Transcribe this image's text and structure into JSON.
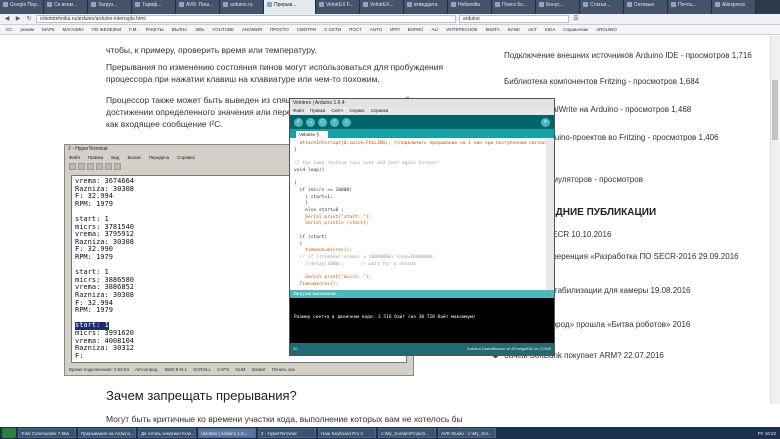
{
  "browser": {
    "tabs": [
      {
        "label": "Google Пер...",
        "active": false
      },
      {
        "label": "Се всем...",
        "active": false
      },
      {
        "label": "Загруз...",
        "active": false
      },
      {
        "label": "Тариф...",
        "active": false
      },
      {
        "label": "AVR: Пиш...",
        "active": false
      },
      {
        "label": "arduino.ru",
        "active": false
      },
      {
        "label": "Прерыв...",
        "active": true
      },
      {
        "label": "VelotrEX F...",
        "active": false
      },
      {
        "label": "VelotrEX...",
        "active": false
      },
      {
        "label": "втведдета",
        "active": false
      },
      {
        "label": "Hellomitla",
        "active": false
      },
      {
        "label": "Поиск бо...",
        "active": false
      },
      {
        "label": "Бонус...",
        "active": false
      },
      {
        "label": "Статьи...",
        "active": false
      },
      {
        "label": "Сетевые",
        "active": false
      },
      {
        "label": "Почта...",
        "active": false
      },
      {
        "label": "Aliexpress",
        "active": false
      }
    ],
    "url": "robototehnika.ru/arduino/arduino-interrupts.html",
    "search_value": "arduino",
    "bookmarks": [
      "СС",
      "режим",
      "МАРК",
      "МАГАЗИН",
      "ПО ЖЕЛЕЗКИ",
      "F.M.",
      "РАКЕТЫ",
      "ВЪЛНА",
      "ЗВЪ",
      "YOUTUBE",
      "АНОМИЯ",
      "ПРОСТО",
      "СМОТРИ",
      "С-СЕТИ",
      "ПОСТ",
      "ANTO",
      "ИРП",
      "БОРИС",
      "ALI",
      "ИНТЕРЕСНОЕ",
      "КНИГА",
      "BANK",
      "AKT",
      "KIDA",
      "Справочник",
      "ARDUINO"
    ]
  },
  "article": {
    "para_top": "чтобы, к примеру, проверить время или температуру.",
    "para1": "Прерывания по изменению состояния пинов могут использоваться для пробуждения процессора при нажатии клавиш на клавиатуре или чем-то похожим.",
    "para2": "Процессор также может быть выведен из спящего режима прерыванием таймера при достижении определенного значения или переполнении, или другими событиями, такими как входящее сообщение I²C.",
    "heading2": "Зачем запрещать прерывания?",
    "para3": "Могут быть критичные ко времени участки кода, выполнение которых вам не хотелось бы"
  },
  "sidebar": {
    "items": [
      "Подключение внешних источников Arduino IDE - просмотров 1,716",
      "Библиотека компонентов Fritzing - просмотров 1,684",
      "Функции digitalWrite на Arduino - просмотров 1,468",
      "Создание Arduino-проектов во Fritzing - просмотров 1,406",
      "Зарядка аккумуляторов - просмотров"
    ],
    "heading": "ПОСЛЕДНИЕ ПУБЛИКАЦИИ",
    "recent": [
      "Доступный SECR 10.10.2016",
      "Научная конференция «Разработка ПО SECR-2016 29.09.2016",
      "Платформа стабилизации для камеры 19.08.2016",
      "Тест «Нано-город» прошла «Битва роботов» 2016",
      "Зачем SoftBank покупает ARM? 22.07.2016"
    ]
  },
  "terminal": {
    "title": "2 - HyperTerminal",
    "menu": [
      "Файл",
      "Правка",
      "Вид",
      "Вызов",
      "Передача",
      "Справка"
    ],
    "lines": [
      {
        "text": "vrema: 3674664",
        "hl": false
      },
      {
        "text": "Razniza: 30308",
        "hl": false
      },
      {
        "text": "F: 32.994",
        "hl": false
      },
      {
        "text": "RPM: 1979",
        "hl": false
      },
      {
        "text": "",
        "hl": false
      },
      {
        "text": "start: 1",
        "hl": false
      },
      {
        "text": "micrs: 3781540",
        "hl": false
      },
      {
        "text": "vrema: 3795912",
        "hl": false
      },
      {
        "text": "Razniza: 30308",
        "hl": false
      },
      {
        "text": "F: 32.990",
        "hl": false
      },
      {
        "text": "RPM: 1979",
        "hl": false
      },
      {
        "text": "",
        "hl": false
      },
      {
        "text": "start: 1",
        "hl": false
      },
      {
        "text": "micrs: 3886580",
        "hl": false
      },
      {
        "text": "vrema: 3886852",
        "hl": false
      },
      {
        "text": "Razniza: 30308",
        "hl": false
      },
      {
        "text": "F: 32.994",
        "hl": false
      },
      {
        "text": "RPM: 1979",
        "hl": false
      },
      {
        "text": "",
        "hl": false
      },
      {
        "text": "start: 1",
        "hl": true
      },
      {
        "text": "micrs: 3991620",
        "hl": false
      },
      {
        "text": "vrema: 4008104",
        "hl": false
      },
      {
        "text": "Razniza: 30312",
        "hl": false
      },
      {
        "text": "F:",
        "hl": false
      }
    ],
    "status": [
      "Время подключения: 0:56:54",
      "Автоопред.",
      "9600 8-N-1",
      "SCROLL",
      "CAPS",
      "NUM",
      "Захват",
      "Печать эха"
    ]
  },
  "ide": {
    "title": "Velotrex | Arduino 1.6.4",
    "menu": [
      "Файл",
      "Правка",
      "Скетч",
      "Сервис",
      "Справка"
    ],
    "tab": "Velotrex §",
    "code_lines": [
      "  attachInterrupt(0,swise,FALLING); //подключить прерывание на 1 пин при поступлении сигнала",
      "}",
      "",
      "// the loop routine runs over and over again forever:",
      "void loop()",
      "",
      "{",
      "  if (micrs >= 10000)",
      "    { start=1;",
      "    }",
      "    else start=0 ;",
      "    Serial.print(\"start: \");",
      "    Serial.println (start);",
      "",
      "  if (start)",
      "  {",
      "    timeout=micros();",
      "  // if ((timeout-vrema) > 10000000) zaza=10000000;",
      "    //delay(1000);      // wait for a second",
      "",
      "    Serial.print(\"micrs: \");",
      "  Time=micros();"
    ],
    "status": "Загрузка выполнена.",
    "console": "Размер скетча в двоичном коде: 3 516 байт (из 30 720 байт максимум)",
    "footer_left": "20",
    "footer_right": "Arduino Duemilanove w/ ATmega328 on COM3"
  },
  "taskbar": {
    "tasks": [
      {
        "label": "Total Commander 7.56a",
        "active": false
      },
      {
        "label": "Прерывания на Arduino...",
        "active": false
      },
      {
        "label": "Де готовь энергию! Kow...",
        "active": false
      },
      {
        "label": "Velotrex | Arduino 1.6...",
        "active": true
      },
      {
        "label": "2 - HyperTerminal",
        "active": false
      },
      {
        "label": "Наш Keyboard Pro 4",
        "active": false
      },
      {
        "label": "c:\\My_Suratin\\Project\\...",
        "active": false
      },
      {
        "label": "AVR Studio - c:\\My_Sur...",
        "active": false
      }
    ],
    "clock": "РУ  16:22"
  }
}
